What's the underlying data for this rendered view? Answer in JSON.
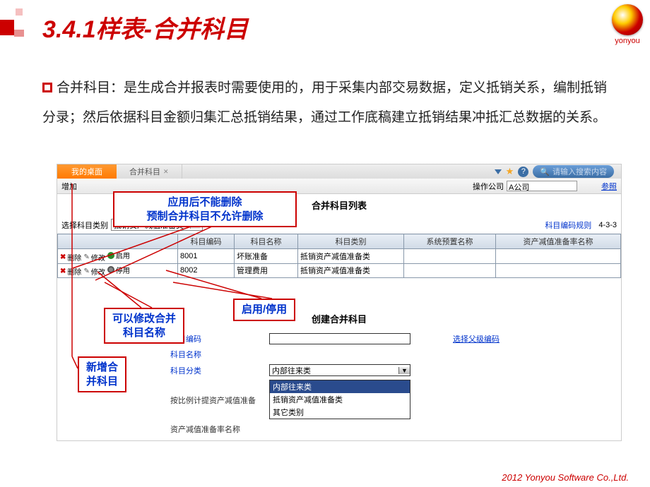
{
  "slide": {
    "title": "3.4.1样表-合并科目",
    "logo_text": "yonyou",
    "paragraph": "合并科目：是生成合并报表时需要使用的，用于采集内部交易数据，定义抵销关系，编制抵销分录；然后依据科目金额归集汇总抵销结果，通过工作底稿建立抵销结果冲抵汇总数据的关系。"
  },
  "app": {
    "tabs": {
      "active": "我的桌面",
      "other": "合并科目"
    },
    "search_placeholder": "请输入搜索内容",
    "row2": {
      "add_label": "增加",
      "op_company_label": "操作公司",
      "op_company_value": "A公司",
      "ref_link": "参照"
    },
    "list": {
      "title": "合并科目列表",
      "select_label": "选择科目类别",
      "select_value": "抵销资产减值准备类",
      "rule_label": "科目编码规则",
      "rule_value": "4-3-3",
      "columns": [
        "",
        "科目编码",
        "科目名称",
        "科目类别",
        "系统预置名称",
        "资产减值准备率名称"
      ],
      "rows": [
        {
          "del": "删除",
          "mod": "修改",
          "toggle": "启用",
          "toggle_type": "green",
          "code": "8001",
          "name": "坏账准备",
          "cat": "抵销资产减值准备类",
          "sys": "",
          "rate": ""
        },
        {
          "del": "删除",
          "mod": "修改",
          "toggle": "停用",
          "toggle_type": "grey",
          "code": "8002",
          "name": "管理费用",
          "cat": "抵销资产减值准备类",
          "sys": "",
          "rate": ""
        }
      ]
    },
    "create": {
      "title": "创建合并科目",
      "code_label": "科目编码",
      "parent_link": "选择父级编码",
      "name_label": "科目名称",
      "class_label": "科目分类",
      "class_value": "内部往来类",
      "ratio_label": "按比例计提资产减值准备",
      "rate_name_label": "资产减值准备率名称",
      "dropdown_options": [
        "内部往来类",
        "抵销资产减值准备类",
        "其它类别"
      ]
    }
  },
  "annotations": {
    "a1_line1": "应用后不能删除",
    "a1_line2": "预制合并科目不允许删除",
    "a2": "启用/停用",
    "a3_line1": "可以修改合并",
    "a3_line2": "科目名称",
    "a4_line1": "新增合",
    "a4_line2": "并科目"
  },
  "footer": "2012 Yonyou Software Co.,Ltd."
}
